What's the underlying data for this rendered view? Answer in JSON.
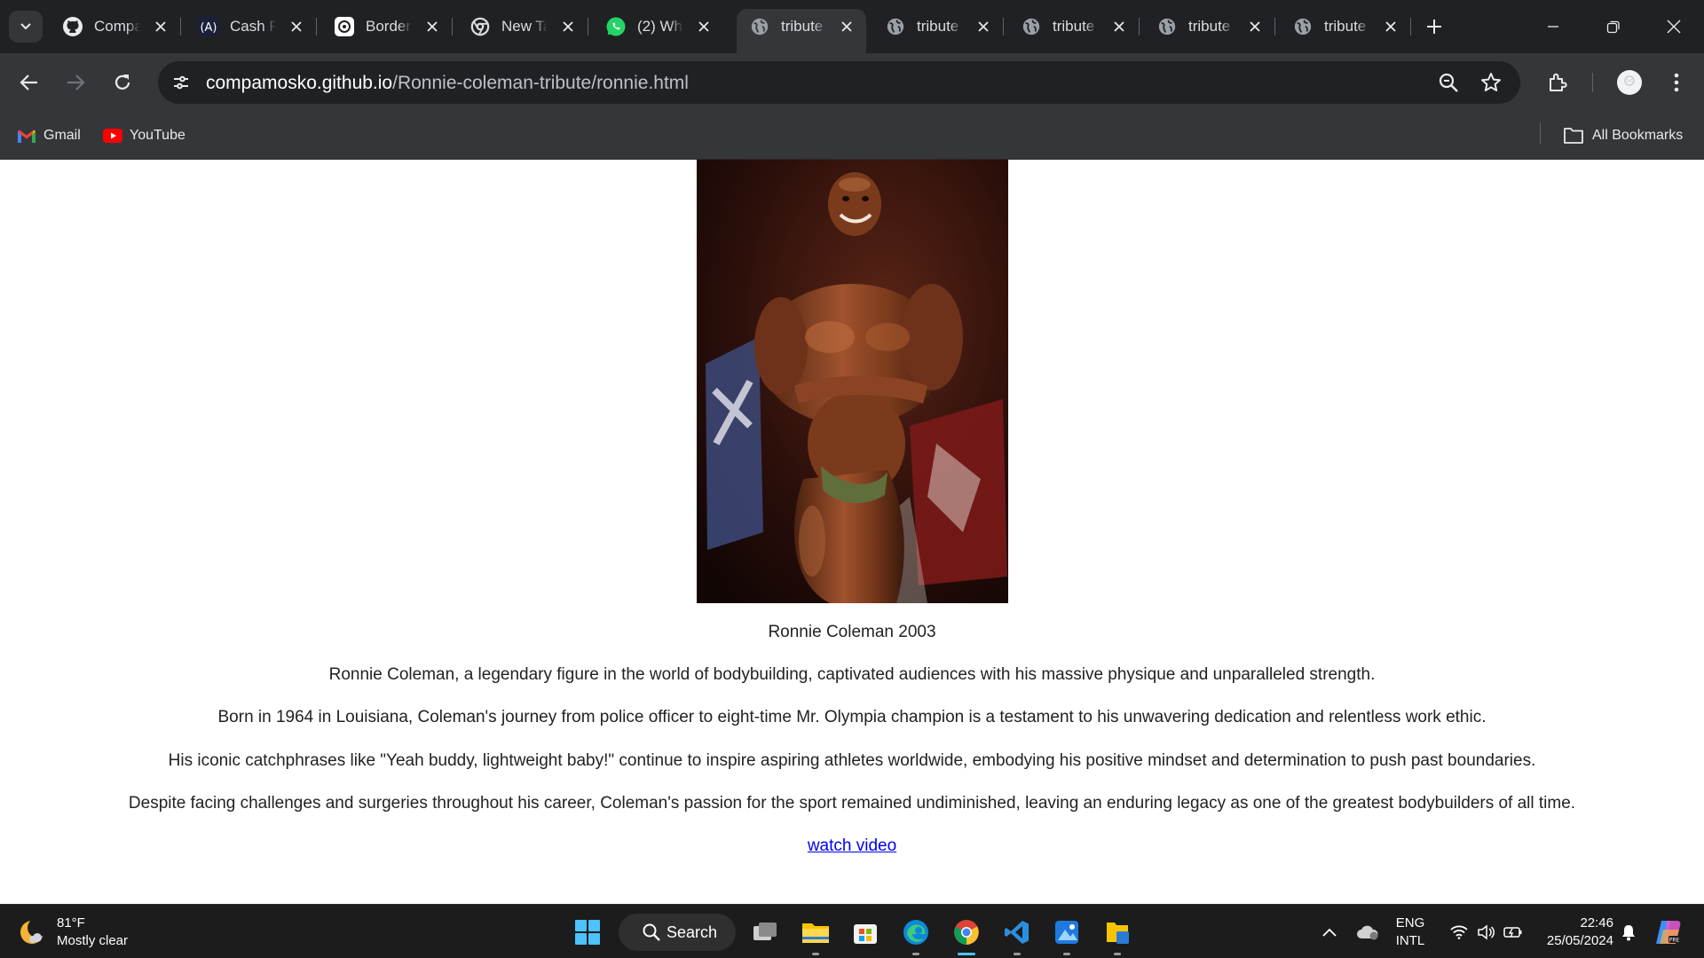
{
  "tabs": [
    {
      "title": "Compa",
      "icon": "github-icon"
    },
    {
      "title": "Cash R",
      "icon": "app-icon"
    },
    {
      "title": "Border",
      "icon": "openai-icon"
    },
    {
      "title": "New Ta",
      "icon": "chrome-icon"
    },
    {
      "title": "(2) Wh",
      "icon": "whatsapp-icon"
    },
    {
      "title": "tribute",
      "icon": "globe-icon",
      "active": true
    },
    {
      "title": "tribute",
      "icon": "globe-icon"
    },
    {
      "title": "tribute",
      "icon": "globe-icon"
    },
    {
      "title": "tribute",
      "icon": "globe-icon"
    },
    {
      "title": "tribute",
      "icon": "globe-icon"
    }
  ],
  "address_bar": {
    "host": "compamosko.github.io",
    "path": "/Ronnie-coleman-tribute/ronnie.html"
  },
  "bookmarks": {
    "items": [
      {
        "label": "Gmail",
        "icon": "gmail-icon"
      },
      {
        "label": "YouTube",
        "icon": "youtube-icon"
      }
    ],
    "all_bookmarks": "All Bookmarks"
  },
  "page": {
    "caption": "Ronnie Coleman 2003",
    "paragraphs": [
      "Ronnie Coleman, a legendary figure in the world of bodybuilding, captivated audiences with his massive physique and unparalleled strength.",
      "Born in 1964 in Louisiana, Coleman's journey from police officer to eight-time Mr. Olympia champion is a testament to his unwavering dedication and relentless work ethic.",
      "His iconic catchphrases like \"Yeah buddy, lightweight baby!\" continue to inspire aspiring athletes worldwide, embodying his positive mindset and determination to push past boundaries.",
      "Despite facing challenges and surgeries throughout his career, Coleman's passion for the sport remained undiminished, leaving an enduring legacy as one of the greatest bodybuilders of all time."
    ],
    "link_text": "watch video"
  },
  "taskbar": {
    "weather_temp": "81°F",
    "weather_desc": "Mostly clear",
    "search_label": "Search",
    "lang_top": "ENG",
    "lang_bottom": "INTL",
    "time": "22:46",
    "date": "25/05/2024"
  },
  "colors": {
    "tabstrip": "#202124",
    "toolbar": "#35363a",
    "link": "#0000ee",
    "taskbar": "#1c1c1c",
    "accent": "#4cc2ff"
  }
}
